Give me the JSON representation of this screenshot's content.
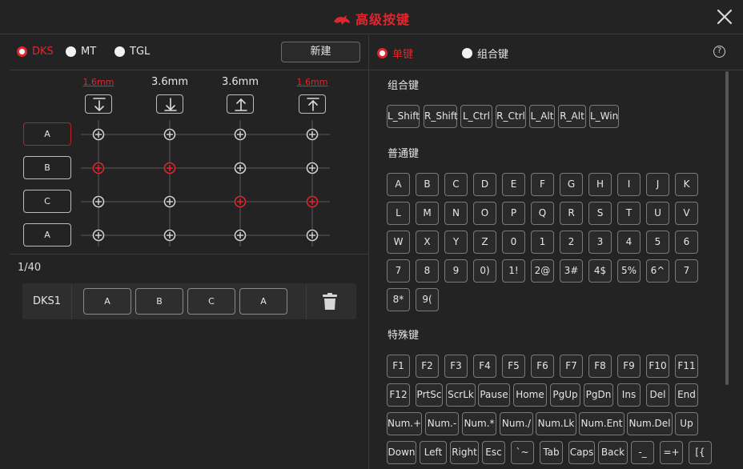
{
  "window": {
    "title": "高级按键"
  },
  "colors": {
    "accent": "#e0262e",
    "bg": "#232323",
    "border": "#7a7a7a"
  },
  "modes": [
    {
      "label": "DKS",
      "selected": true
    },
    {
      "label": "MT",
      "selected": false
    },
    {
      "label": "TGL",
      "selected": false
    }
  ],
  "new_button": "新建",
  "dks": {
    "distances": [
      "1.6mm",
      "3.6mm",
      "3.6mm",
      "1.6mm"
    ],
    "distance_highlight": [
      true,
      false,
      false,
      true
    ],
    "directions": [
      "press-down-full",
      "press-down",
      "release-up",
      "release-up-full"
    ],
    "keys": [
      "A",
      "B",
      "C",
      "A"
    ],
    "active": [
      [
        false,
        false,
        false,
        false
      ],
      [
        true,
        true,
        false,
        false
      ],
      [
        false,
        false,
        true,
        true
      ],
      [
        false,
        false,
        false,
        false
      ]
    ]
  },
  "page_info": "1/40",
  "entry": {
    "name": "DKS1",
    "keys": [
      "A",
      "B",
      "C",
      "A"
    ]
  },
  "keytype": [
    {
      "label": "单键",
      "selected": true
    },
    {
      "label": "组合键",
      "selected": false
    }
  ],
  "help_icon": "?",
  "sections": {
    "combo": {
      "title": "组合键",
      "keys": [
        "L_Shift",
        "R_Shift",
        "L_Ctrl",
        "R_Ctrl",
        "L_Alt",
        "R_Alt",
        "L_Win"
      ]
    },
    "normal": {
      "title": "普通键",
      "rows": [
        [
          "A",
          "B",
          "C",
          "D",
          "E",
          "F",
          "G",
          "H",
          "I",
          "J",
          "K"
        ],
        [
          "L",
          "M",
          "N",
          "O",
          "P",
          "Q",
          "R",
          "S",
          "T",
          "U",
          "V"
        ],
        [
          "W",
          "X",
          "Y",
          "Z",
          "0",
          "1",
          "2",
          "3",
          "4",
          "5",
          "6"
        ],
        [
          "7",
          "8",
          "9",
          "0)",
          "1!",
          "2@",
          "3#",
          "4$",
          "5%",
          "6^",
          "7"
        ],
        [
          "8*",
          "9("
        ]
      ]
    },
    "special": {
      "title": "特殊键",
      "rows": [
        [
          "F1",
          "F2",
          "F3",
          "F4",
          "F5",
          "F6",
          "F7",
          "F8",
          "F9",
          "F10",
          "F11"
        ],
        [
          "F12",
          "PrtSc",
          "ScrLk",
          "Pause",
          "Home",
          "PgUp",
          "PgDn",
          "Ins",
          "Del",
          "End"
        ],
        [
          "Num.+",
          "Num.-",
          "Num.*",
          "Num./",
          "Num.Lk",
          "Num.Ent",
          "Num.Del",
          "Up"
        ],
        [
          "Down",
          "Left",
          "Right",
          "Esc",
          "`~",
          "Tab",
          "Caps",
          "Back",
          "-_",
          "=+",
          "[{"
        ]
      ]
    }
  }
}
